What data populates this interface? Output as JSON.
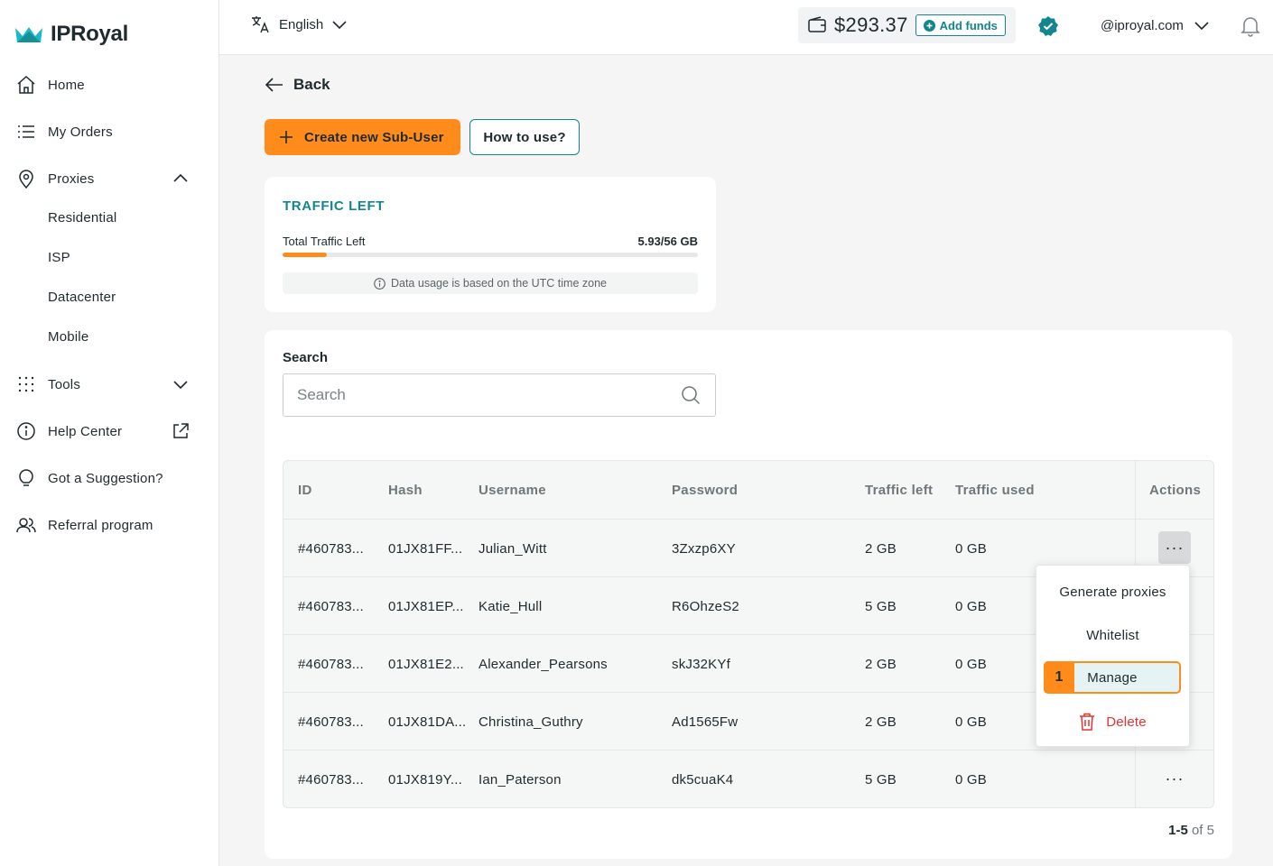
{
  "brand": {
    "name": "IPRoyal"
  },
  "sidebar": {
    "items": [
      {
        "label": "Home",
        "icon": "home-icon"
      },
      {
        "label": "My Orders",
        "icon": "list-icon"
      },
      {
        "label": "Proxies",
        "icon": "location-pin-icon"
      },
      {
        "label": "Tools",
        "icon": "grid-dots-icon"
      },
      {
        "label": "Help Center",
        "icon": "info-icon"
      },
      {
        "label": "Got a Suggestion?",
        "icon": "lightbulb-icon"
      },
      {
        "label": "Referral program",
        "icon": "users-icon"
      }
    ],
    "proxies_sub": [
      "Residential",
      "ISP",
      "Datacenter",
      "Mobile"
    ]
  },
  "topbar": {
    "language": "English",
    "balance": "$293.37",
    "add_funds": "Add funds",
    "account": "@iproyal.com"
  },
  "page": {
    "back": "Back",
    "create_button": "Create new Sub-User",
    "how_to_button": "How to use?"
  },
  "traffic": {
    "title": "TRAFFIC LEFT",
    "label": "Total Traffic Left",
    "value": "5.93/56 GB",
    "fraction": 0.106,
    "note": "Data usage is based on the UTC time zone"
  },
  "search": {
    "label": "Search",
    "placeholder": "Search"
  },
  "table": {
    "headers": [
      "ID",
      "Hash",
      "Username",
      "Password",
      "Traffic left",
      "Traffic used",
      "Actions"
    ],
    "rows": [
      [
        "#460783...",
        "01JX81FF...",
        "Julian_Witt",
        "3Zxzp6XY",
        "2 GB",
        "0 GB"
      ],
      [
        "#460783...",
        "01JX81EP...",
        "Katie_Hull",
        "R6OhzeS2",
        "5 GB",
        "0 GB"
      ],
      [
        "#460783...",
        "01JX81E2...",
        "Alexander_Pearsons",
        "skJ32KYf",
        "2 GB",
        "0 GB"
      ],
      [
        "#460783...",
        "01JX81DA...",
        "Christina_Guthry",
        "Ad1565Fw",
        "2 GB",
        "0 GB"
      ],
      [
        "#460783...",
        "01JX819Y...",
        "Ian_Paterson",
        "dk5cuaK4",
        "5 GB",
        "0 GB"
      ]
    ],
    "actions_glyph": "···"
  },
  "menu": {
    "items": [
      "Generate proxies",
      "Whitelist",
      "Manage",
      "Delete"
    ],
    "highlight_badge": "1"
  },
  "pagination": {
    "range": "1-5",
    "of_text": "of 5"
  },
  "colors": {
    "accent": "#13858e",
    "primary": "#ff8c1a",
    "danger": "#e5322d"
  }
}
